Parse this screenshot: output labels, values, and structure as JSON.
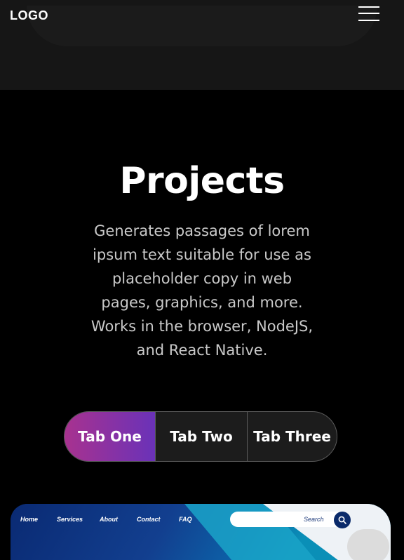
{
  "header": {
    "logo": "LOGO",
    "menu_icon": "hamburger-menu-icon"
  },
  "section": {
    "title": "Projects",
    "description": "Generates passages of lorem ipsum text suitable for use as placeholder copy in web pages, graphics, and more. Works in the browser, NodeJS, and React Native."
  },
  "tabs": [
    {
      "label": "Tab One",
      "active": true
    },
    {
      "label": "Tab Two",
      "active": false
    },
    {
      "label": "Tab Three",
      "active": false
    }
  ],
  "preview": {
    "nav": [
      "Home",
      "Services",
      "About",
      "Contact",
      "FAQ"
    ],
    "search_label": "Search",
    "search_icon": "search-icon"
  },
  "colors": {
    "background": "#000000",
    "header_bg": "#161616",
    "tab_active_gradient_start": "#a8328f",
    "tab_active_gradient_end": "#6a32b8",
    "description_text": "#c9c9c9"
  }
}
